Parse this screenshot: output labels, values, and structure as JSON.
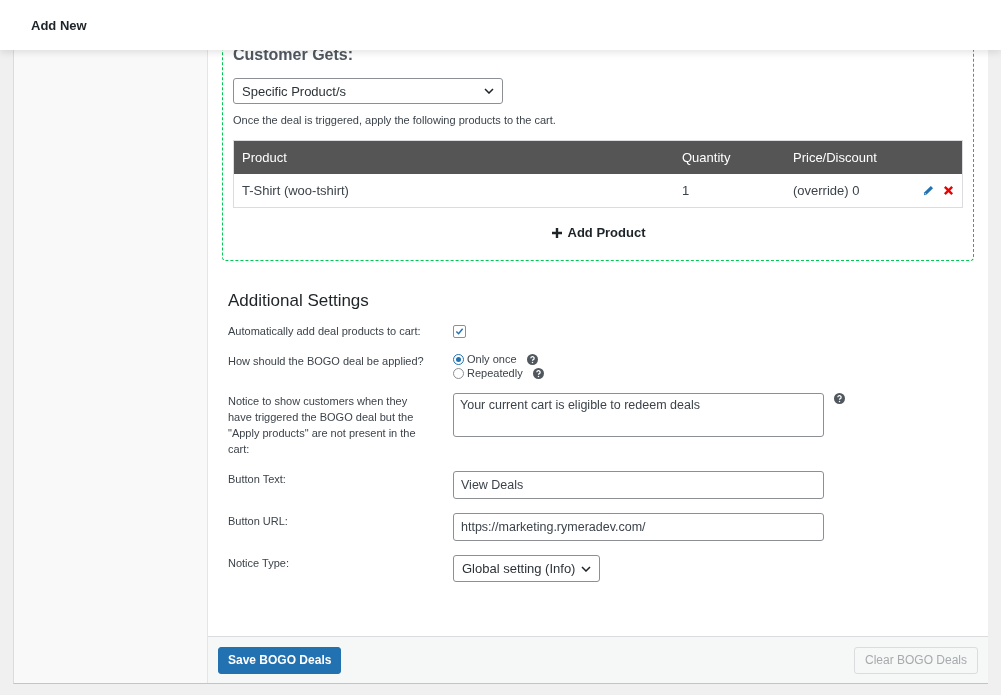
{
  "header": {
    "title": "Add New"
  },
  "customer_gets": {
    "heading": "Customer Gets:",
    "select": {
      "value": "Specific Product/s"
    },
    "help_text": "Once the deal is triggered, apply the following products to the cart.",
    "table": {
      "columns": [
        "Product",
        "Quantity",
        "Price/Discount"
      ],
      "rows": [
        {
          "product": "T-Shirt (woo-tshirt)",
          "quantity": "1",
          "price": "(override) 0"
        }
      ]
    },
    "add_button": {
      "label": "Add Product"
    }
  },
  "additional_settings": {
    "heading": "Additional Settings",
    "fields": [
      {
        "kind": "checkbox",
        "label": "Automatically add deal products to cart:",
        "checked": true
      },
      {
        "kind": "radio",
        "label": "How should the BOGO deal be applied?",
        "options": [
          {
            "label": "Only once",
            "selected": true,
            "help": true
          },
          {
            "label": "Repeatedly",
            "selected": false,
            "help": true
          }
        ]
      },
      {
        "kind": "textarea",
        "label": "Notice to show customers when they have triggered the BOGO deal but the \"Apply products\" are not present in the cart:",
        "value": "Your current cart is eligible to redeem deals",
        "help": true
      },
      {
        "kind": "text",
        "label": "Button Text:",
        "value": "View Deals"
      },
      {
        "kind": "text",
        "label": "Button URL:",
        "value": "https://marketing.rymeradev.com/"
      },
      {
        "kind": "select",
        "label": "Notice Type:",
        "value": "Global setting (Info)"
      }
    ]
  },
  "footer": {
    "save_button": "Save BOGO Deals",
    "clear_button": {
      "label": "Clear BOGO Deals",
      "disabled": true
    }
  }
}
